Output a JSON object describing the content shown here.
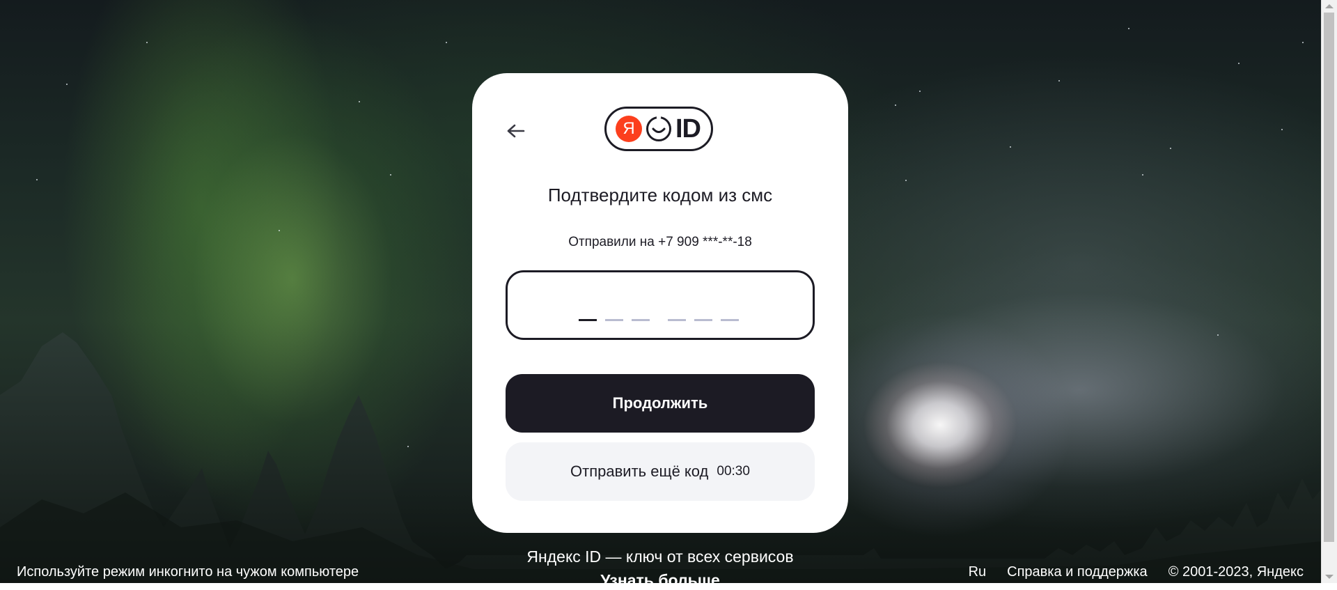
{
  "colors": {
    "card_background": "#ffffff",
    "primary_button": "#1c1b24",
    "secondary_button": "#f3f4f7",
    "logo_red": "#fc3f1d",
    "text_dark": "#1c1b24",
    "code_slot_inactive": "#b9bcd0"
  },
  "logo": {
    "letter": "Я",
    "text": "ID"
  },
  "card": {
    "title": "Подтвердите кодом из смс",
    "subtitle": "Отправили на +7 909 ***-**-18",
    "code_input": {
      "value": "",
      "slots_total": 6,
      "active_slot": 1
    },
    "continue_button": "Продолжить",
    "resend_button": {
      "label": "Отправить ещё код",
      "timer": "00:30"
    }
  },
  "promo": {
    "tagline": "Яндекс ID — ключ от всех сервисов",
    "learn_more": "Узнать больше"
  },
  "footer": {
    "incognito_tip": "Используйте режим инкогнито на чужом компьютере",
    "language": "Ru",
    "help": "Справка и поддержка",
    "copyright": "© 2001-2023, Яндекс"
  },
  "icons": {
    "back": "arrow-left-icon",
    "logo_face": "smile-icon"
  }
}
